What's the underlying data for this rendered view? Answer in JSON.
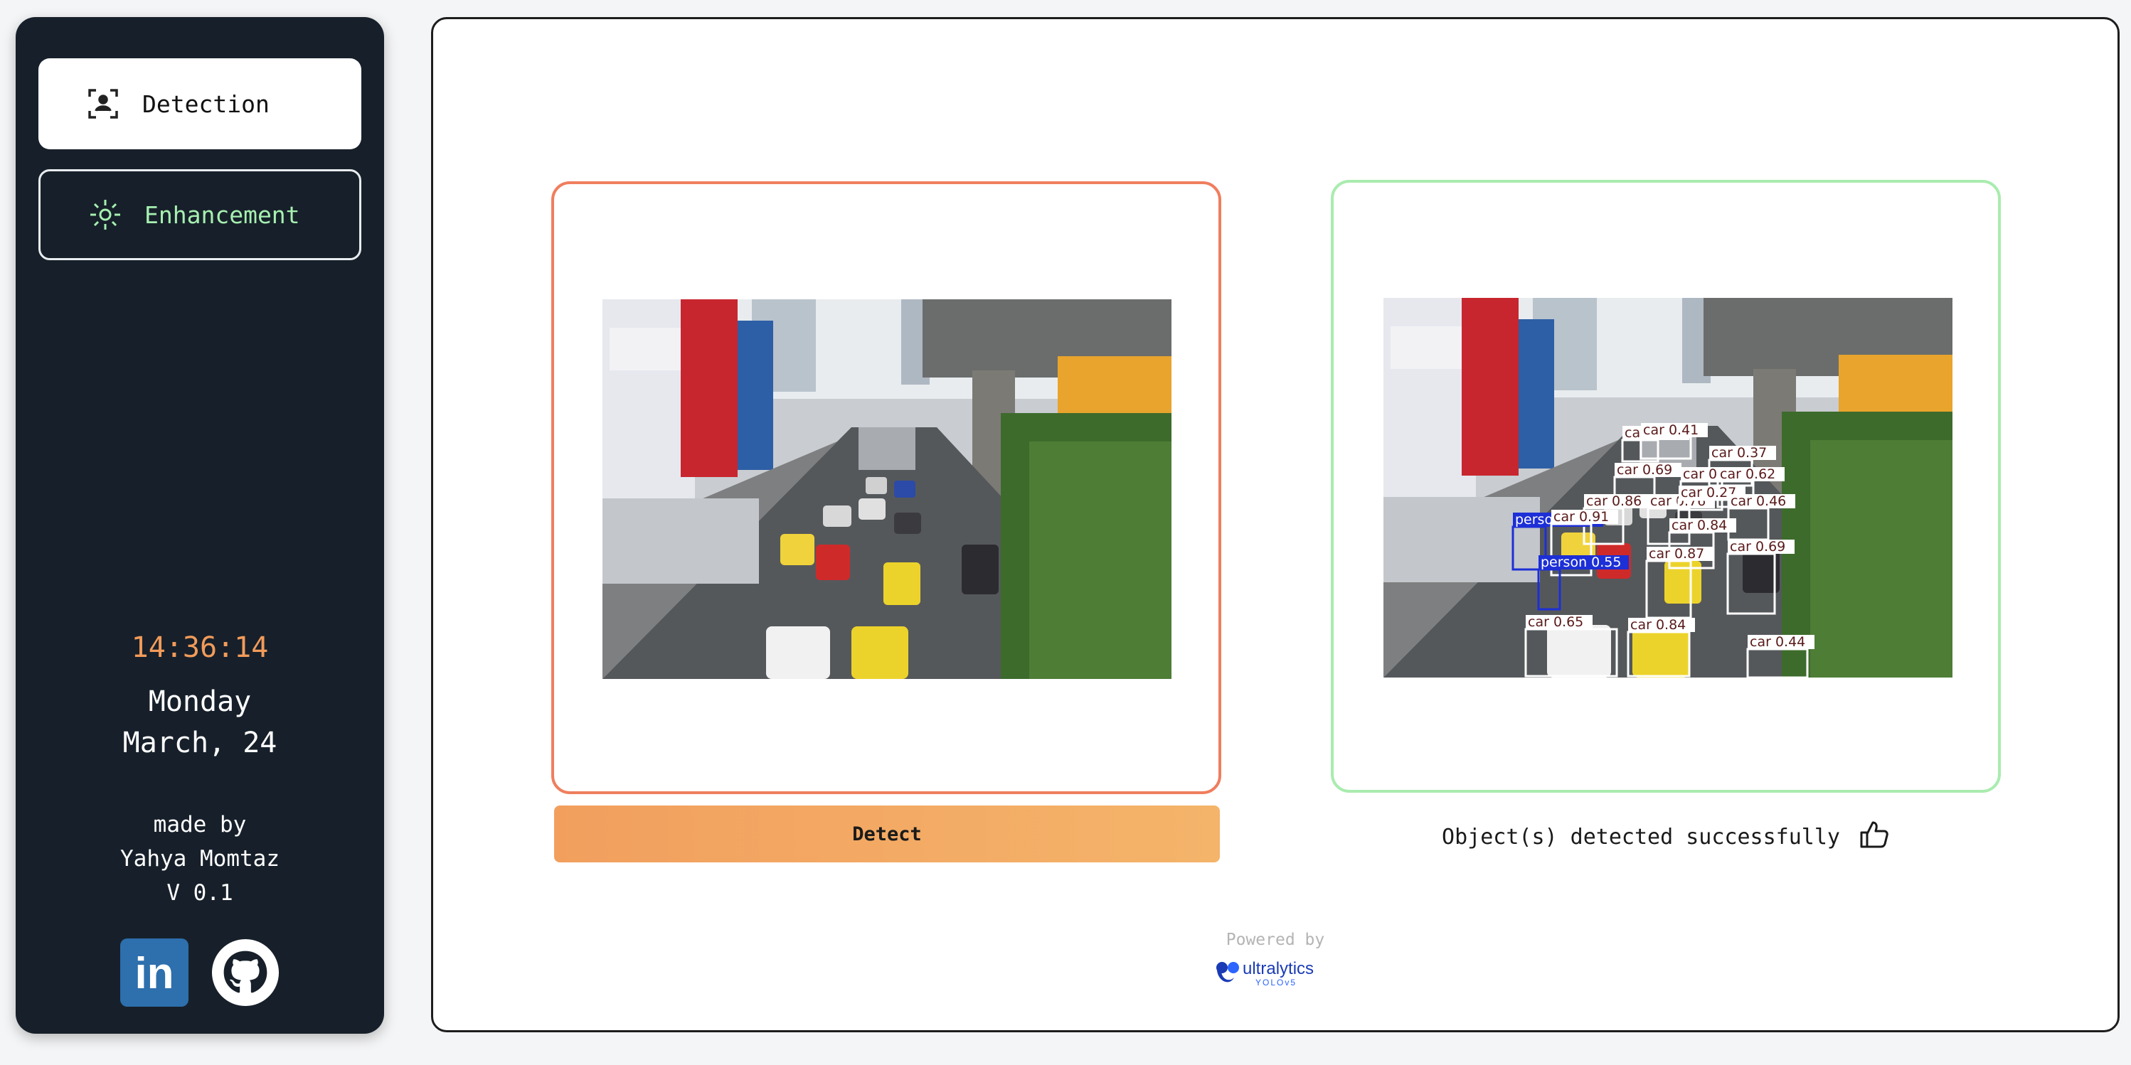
{
  "sidebar": {
    "nav": [
      {
        "label": "Detection",
        "icon": "person-scan-icon",
        "active": true
      },
      {
        "label": "Enhancement",
        "icon": "sparkle-icon",
        "active": false
      }
    ],
    "clock": "14:36:14",
    "day": "Monday",
    "date": "March, 24",
    "credits": {
      "made_by": "made by",
      "author": "Yahya Momtaz",
      "version": "V 0.1"
    },
    "socials": [
      {
        "name": "LinkedIn",
        "icon": "linkedin-icon",
        "glyph": "in"
      },
      {
        "name": "GitHub",
        "icon": "github-icon"
      }
    ]
  },
  "main": {
    "input_image": {
      "content": "street-traffic-photo"
    },
    "output_image": {
      "content": "street-traffic-photo-with-detections"
    },
    "detect_button": "Detect",
    "status_text": "Object(s) detected successfully",
    "status_icon": "thumbs-up-icon",
    "powered_by": "Powered by",
    "logo": {
      "name": "ultralytics",
      "sub": "YOLOv5"
    }
  },
  "detections": [
    {
      "label": "car 0.25"
    },
    {
      "label": "car 0.41"
    },
    {
      "label": "car 0.37"
    },
    {
      "label": "car 0.69"
    },
    {
      "label": "car 0.64"
    },
    {
      "label": "car 0.62"
    },
    {
      "label": "car 0.86"
    },
    {
      "label": "car 0.76"
    },
    {
      "label": "car 0.27"
    },
    {
      "label": "car 0.46"
    },
    {
      "label": "car 0.84"
    },
    {
      "label": "person 0.35"
    },
    {
      "label": "car 0.91"
    },
    {
      "label": "car 0.87"
    },
    {
      "label": "car 0.69"
    },
    {
      "label": "person 0.55"
    },
    {
      "label": "car 0.65"
    },
    {
      "label": "car 0.84"
    },
    {
      "label": "car 0.44"
    }
  ],
  "colors": {
    "sidebar_bg": "#17202a",
    "accent_orange": "#f29b5a",
    "input_border": "#ef7e5e",
    "output_border": "#a9ecae",
    "enhance_text": "#a6f0b0",
    "car_box": "#ffffff",
    "person_box": "#1d2fd6"
  }
}
